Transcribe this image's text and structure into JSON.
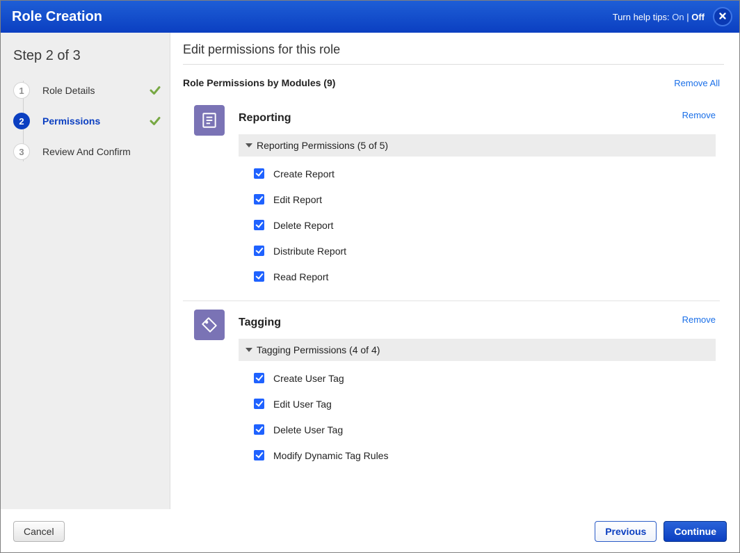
{
  "header": {
    "title": "Role Creation",
    "help_label": "Turn help tips:",
    "help_on": "On",
    "help_sep": "|",
    "help_off": "Off"
  },
  "sidebar": {
    "heading": "Step 2 of 3",
    "steps": [
      {
        "num": "1",
        "label": "Role Details",
        "done": true,
        "current": false
      },
      {
        "num": "2",
        "label": "Permissions",
        "done": true,
        "current": true
      },
      {
        "num": "3",
        "label": "Review And Confirm",
        "done": false,
        "current": false
      }
    ]
  },
  "main": {
    "title": "Edit permissions for this role",
    "permissions_label": "Role Permissions by Modules (9)",
    "remove_all": "Remove All"
  },
  "modules": [
    {
      "icon": "report-icon",
      "title": "Reporting",
      "remove_label": "Remove",
      "group_heading": "Reporting Permissions (5 of 5)",
      "permissions": [
        "Create Report",
        "Edit Report",
        "Delete Report",
        "Distribute Report",
        "Read Report"
      ]
    },
    {
      "icon": "tag-icon",
      "title": "Tagging",
      "remove_label": "Remove",
      "group_heading": "Tagging Permissions (4 of 4)",
      "permissions": [
        "Create User Tag",
        "Edit User Tag",
        "Delete User Tag",
        "Modify Dynamic Tag Rules"
      ]
    }
  ],
  "footer": {
    "cancel": "Cancel",
    "previous": "Previous",
    "continue": "Continue"
  }
}
